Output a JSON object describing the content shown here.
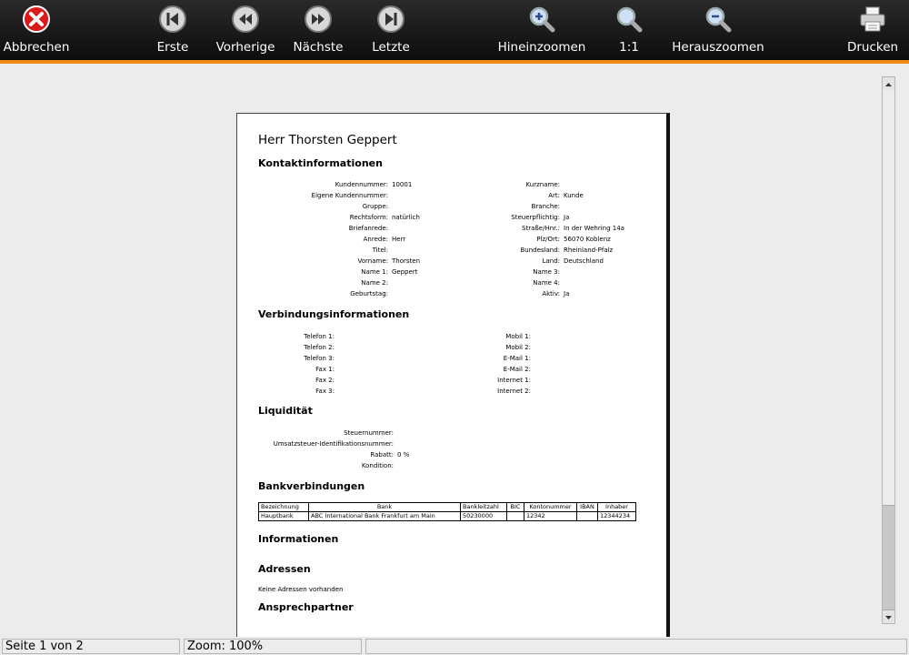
{
  "toolbar": {
    "cancel": "Abbrechen",
    "first": "Erste",
    "previous": "Vorherige",
    "next": "Nächste",
    "last": "Letzte",
    "zoom_in": "Hineinzoomen",
    "zoom_reset": "1:1",
    "zoom_out": "Herauszoomen",
    "print": "Drucken",
    "accent_color": "#f08a18"
  },
  "document": {
    "title": "Herr Thorsten Geppert",
    "contact_heading": "Kontaktinformationen",
    "contact_left": [
      {
        "label": "Kundennummer:",
        "value": "10001"
      },
      {
        "label": "Eigene Kundennummer:",
        "value": ""
      },
      {
        "label": "Gruppe:",
        "value": ""
      },
      {
        "label": "Rechtsform:",
        "value": "natürlich"
      },
      {
        "label": "Briefanrede:",
        "value": ""
      },
      {
        "label": "Anrede:",
        "value": "Herr"
      },
      {
        "label": "Titel:",
        "value": ""
      },
      {
        "label": "Vorname:",
        "value": "Thorsten"
      },
      {
        "label": "Name 1:",
        "value": "Geppert"
      },
      {
        "label": "Name 2:",
        "value": ""
      },
      {
        "label": "Geburtstag:",
        "value": ""
      }
    ],
    "contact_right": [
      {
        "label": "Kurzname:",
        "value": ""
      },
      {
        "label": "Art:",
        "value": "Kunde"
      },
      {
        "label": "Branche:",
        "value": ""
      },
      {
        "label": "Steuerpflichtig:",
        "value": "Ja"
      },
      {
        "label": "Straße/Hnr.:",
        "value": "In der Wehring 14a"
      },
      {
        "label": "Plz/Ort:",
        "value": "56070 Koblenz"
      },
      {
        "label": "Bundesland:",
        "value": "Rheinland-Pfalz"
      },
      {
        "label": "Land:",
        "value": "Deutschland"
      },
      {
        "label": "Name 3:",
        "value": ""
      },
      {
        "label": "Name 4:",
        "value": ""
      },
      {
        "label": "Aktiv:",
        "value": "Ja"
      }
    ],
    "connection_heading": "Verbindungsinformationen",
    "connection_left": [
      {
        "label": "Telefon 1:",
        "value": ""
      },
      {
        "label": "Telefon 2:",
        "value": ""
      },
      {
        "label": "Telefon 3:",
        "value": ""
      },
      {
        "label": "Fax 1:",
        "value": ""
      },
      {
        "label": "Fax 2:",
        "value": ""
      },
      {
        "label": "Fax 3:",
        "value": ""
      }
    ],
    "connection_right": [
      {
        "label": "Mobil 1:",
        "value": ""
      },
      {
        "label": "Mobil 2:",
        "value": ""
      },
      {
        "label": "E-Mail 1:",
        "value": ""
      },
      {
        "label": "E-Mail 2:",
        "value": ""
      },
      {
        "label": "Internet 1:",
        "value": ""
      },
      {
        "label": "Internet 2:",
        "value": ""
      }
    ],
    "liquidity_heading": "Liquidität",
    "liquidity": [
      {
        "label": "Steuernummer:",
        "value": ""
      },
      {
        "label": "Umsatzsteuer-Identifikationsnummer:",
        "value": ""
      },
      {
        "label": "Rabatt:",
        "value": "0 %"
      },
      {
        "label": "Kondition:",
        "value": ""
      }
    ],
    "bank_heading": "Bankverbindungen",
    "bank_table": {
      "headers": [
        "Bezeichnung",
        "Bank",
        "Bankleitzahl",
        "BIC",
        "Kontonummer",
        "IBAN",
        "Inhaber"
      ],
      "rows": [
        [
          "Hauptbank",
          "ABC International Bank Frankfurt am Main",
          "50230000",
          "",
          "12342",
          "",
          "12344234"
        ]
      ]
    },
    "info_heading": "Informationen",
    "address_heading": "Adressen",
    "address_note": "Keine Adressen vorhanden",
    "contacts_heading": "Ansprechpartner"
  },
  "status": {
    "page": "Seite 1 von 2",
    "zoom": "Zoom: 100%",
    "message": ""
  }
}
